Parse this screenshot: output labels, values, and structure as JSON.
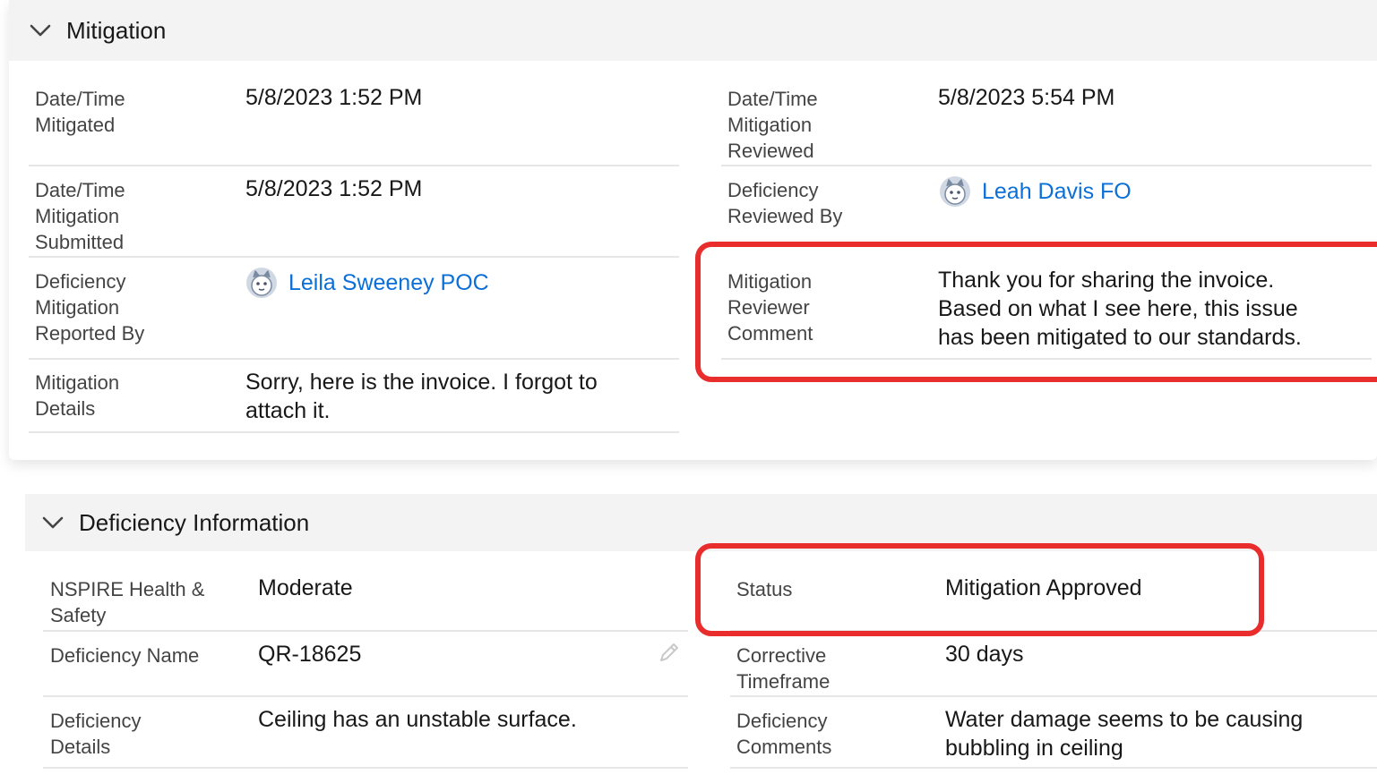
{
  "mitigation": {
    "title": "Mitigation",
    "fields": {
      "datetime_mitigated": {
        "label": "Date/Time\nMitigated",
        "value": "5/8/2023 1:52 PM"
      },
      "datetime_reviewed": {
        "label": "Date/Time\nMitigation\nReviewed",
        "value": "5/8/2023 5:54 PM"
      },
      "datetime_submitted": {
        "label": "Date/Time\nMitigation\nSubmitted",
        "value": "5/8/2023 1:52 PM"
      },
      "deficiency_reviewed_by": {
        "label": "Deficiency\nReviewed By",
        "value": "Leah Davis FO"
      },
      "reported_by": {
        "label": "Deficiency\nMitigation\nReported By",
        "value": "Leila Sweeney POC"
      },
      "reviewer_comment": {
        "label": "Mitigation\nReviewer\nComment",
        "value": "Thank you for sharing the invoice.\nBased on what I see here, this issue\nhas been mitigated to our standards."
      },
      "mitigation_details": {
        "label": "Mitigation\nDetails",
        "value": "Sorry, here is the invoice. I forgot to\nattach it."
      }
    }
  },
  "deficiency": {
    "title": "Deficiency Information",
    "fields": {
      "nspire": {
        "label": "NSPIRE Health &\nSafety",
        "value": "Moderate"
      },
      "status": {
        "label": "Status",
        "value": "Mitigation Approved"
      },
      "name": {
        "label": "Deficiency Name",
        "value": "QR-18625"
      },
      "timeframe": {
        "label": "Corrective\nTimeframe",
        "value": "30 days"
      },
      "details": {
        "label": "Deficiency\nDetails",
        "value": "Ceiling has an unstable surface."
      },
      "comments": {
        "label": "Deficiency\nComments",
        "value": "Water damage seems to be causing\nbubbling in ceiling"
      }
    }
  },
  "colors": {
    "highlight": "#e92d2d",
    "link": "#0b6fd8",
    "header_bg": "#f3f3f3"
  },
  "icons": {
    "section_toggle": "chevron-down-icon",
    "user": "user-avatar-icon",
    "edit": "pencil-icon"
  }
}
